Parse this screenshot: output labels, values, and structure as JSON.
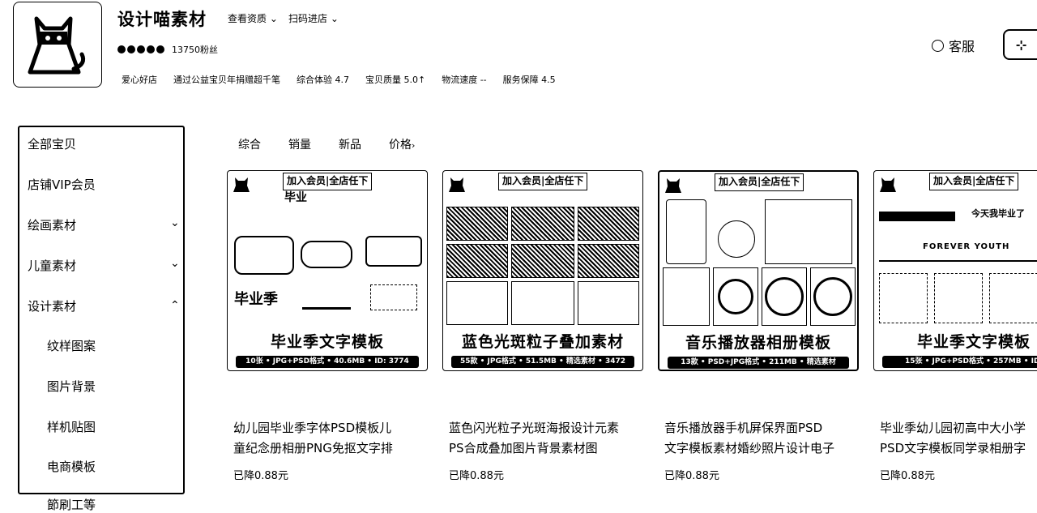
{
  "shop": {
    "name": "设计喵素材",
    "nav_browse": "查看资质",
    "nav_scan": "扫码进店",
    "fans": "13750粉丝",
    "stats": [
      "爱心好店",
      "通过公益宝贝年捐赠超千笔",
      "综合体验 4.7",
      "宝贝质量 5.0↑",
      "物流速度 --",
      "服务保障 4.5"
    ]
  },
  "service": {
    "label": "客服"
  },
  "sidebar": {
    "items": [
      {
        "label": "全部宝贝",
        "level": 1,
        "chevron": ""
      },
      {
        "label": "店铺VIP会员",
        "level": 1,
        "chevron": ""
      },
      {
        "label": "绘画素材",
        "level": 1,
        "chevron": "down"
      },
      {
        "label": "儿童素材",
        "level": 1,
        "chevron": "down"
      },
      {
        "label": "设计素材",
        "level": 1,
        "chevron": "up"
      },
      {
        "label": "纹样图案",
        "level": 2,
        "chevron": ""
      },
      {
        "label": "图片背景",
        "level": 2,
        "chevron": ""
      },
      {
        "label": "样机贴图",
        "level": 2,
        "chevron": ""
      },
      {
        "label": "电商模板",
        "level": 2,
        "chevron": ""
      }
    ],
    "cut_item": "節刷工等"
  },
  "sort": {
    "comprehensive": "综合",
    "sales": "销量",
    "new": "新品",
    "price": "价格"
  },
  "products": [
    {
      "banner": "加入会员|全店任下",
      "caption": "毕业季文字模板",
      "spec": "10张 • JPG+PSD格式 • 40.6MB • ID: 3774",
      "title_line1": "幼儿园毕业季字体PSD模板儿",
      "title_line2": "童纪念册相册PNG免抠文字排",
      "price": "已降0.88元"
    },
    {
      "banner": "加入会员|全店任下",
      "caption": "蓝色光斑粒子叠加素材",
      "spec": "55款 • JPG格式 • 51.5MB • 精选素材 • 3472",
      "title_line1": "蓝色闪光粒子光斑海报设计元素",
      "title_line2": "PS合成叠加图片背景素材图",
      "price": "已降0.88元"
    },
    {
      "banner": "加入会员|全店任下",
      "caption": "音乐播放器相册模板",
      "spec": "13款 • PSD+JPG格式 • 211MB • 精选素材",
      "title_line1": "音乐播放器手机屏保界面PSD",
      "title_line2": "文字模板素材婚纱照片设计电子",
      "price": "已降0.88元"
    },
    {
      "banner": "加入会员|全店任下",
      "caption": "毕业季文字模板",
      "spec": "15张 • JPG+PSD格式 • 257MB • ID:",
      "title_line1": "毕业季幼儿园初高中大小学",
      "title_line2": "PSD文字模板同学录相册字",
      "price": "已降0.88元"
    }
  ]
}
